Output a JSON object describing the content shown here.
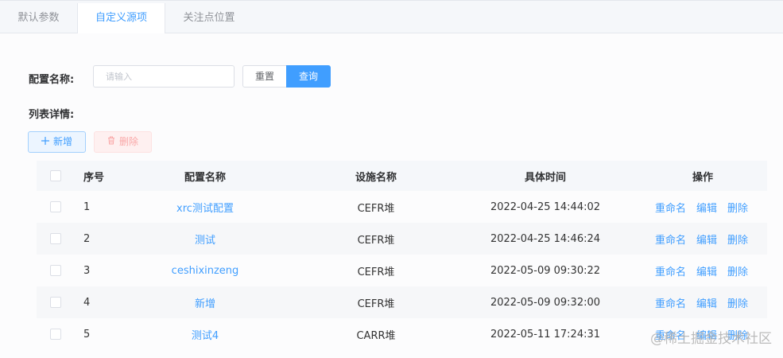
{
  "tabs": [
    {
      "label": "默认参数"
    },
    {
      "label": "自定义源项"
    },
    {
      "label": "关注点位置"
    }
  ],
  "form": {
    "config_name_label": "配置名称:",
    "input_placeholder": "请输入",
    "reset_label": "重置",
    "query_label": "查询"
  },
  "list": {
    "title": "列表详情:",
    "add_label": "新增",
    "delete_label": "删除",
    "add_icon": "plus-icon",
    "delete_icon": "trash-icon"
  },
  "table": {
    "headers": {
      "index": "序号",
      "config_name": "配置名称",
      "facility_name": "设施名称",
      "time": "具体时间",
      "actions": "操作"
    },
    "rows": [
      {
        "index": "1",
        "config_name": "xrc测试配置",
        "facility_name": "CEFR堆",
        "time": "2022-04-25 14:44:02",
        "rename": "重命名",
        "edit": "编辑",
        "delete": "删除"
      },
      {
        "index": "2",
        "config_name": "测试",
        "facility_name": "CEFR堆",
        "time": "2022-04-25 14:46:24",
        "rename": "重命名",
        "edit": "编辑",
        "delete": "删除"
      },
      {
        "index": "3",
        "config_name": "ceshixinzeng",
        "facility_name": "CEFR堆",
        "time": "2022-05-09 09:30:22",
        "rename": "重命名",
        "edit": "编辑",
        "delete": "删除"
      },
      {
        "index": "4",
        "config_name": "新增",
        "facility_name": "CEFR堆",
        "time": "2022-05-09 09:32:00",
        "rename": "重命名",
        "edit": "编辑",
        "delete": "删除"
      },
      {
        "index": "5",
        "config_name": "测试4",
        "facility_name": "CARR堆",
        "time": "2022-05-11 17:24:31",
        "rename": "重命名",
        "edit": "编辑",
        "delete": "删除"
      }
    ]
  },
  "watermark": "@稀土掘金技术社区",
  "colors": {
    "accent": "#409eff",
    "danger_light": "#fef0f0"
  }
}
